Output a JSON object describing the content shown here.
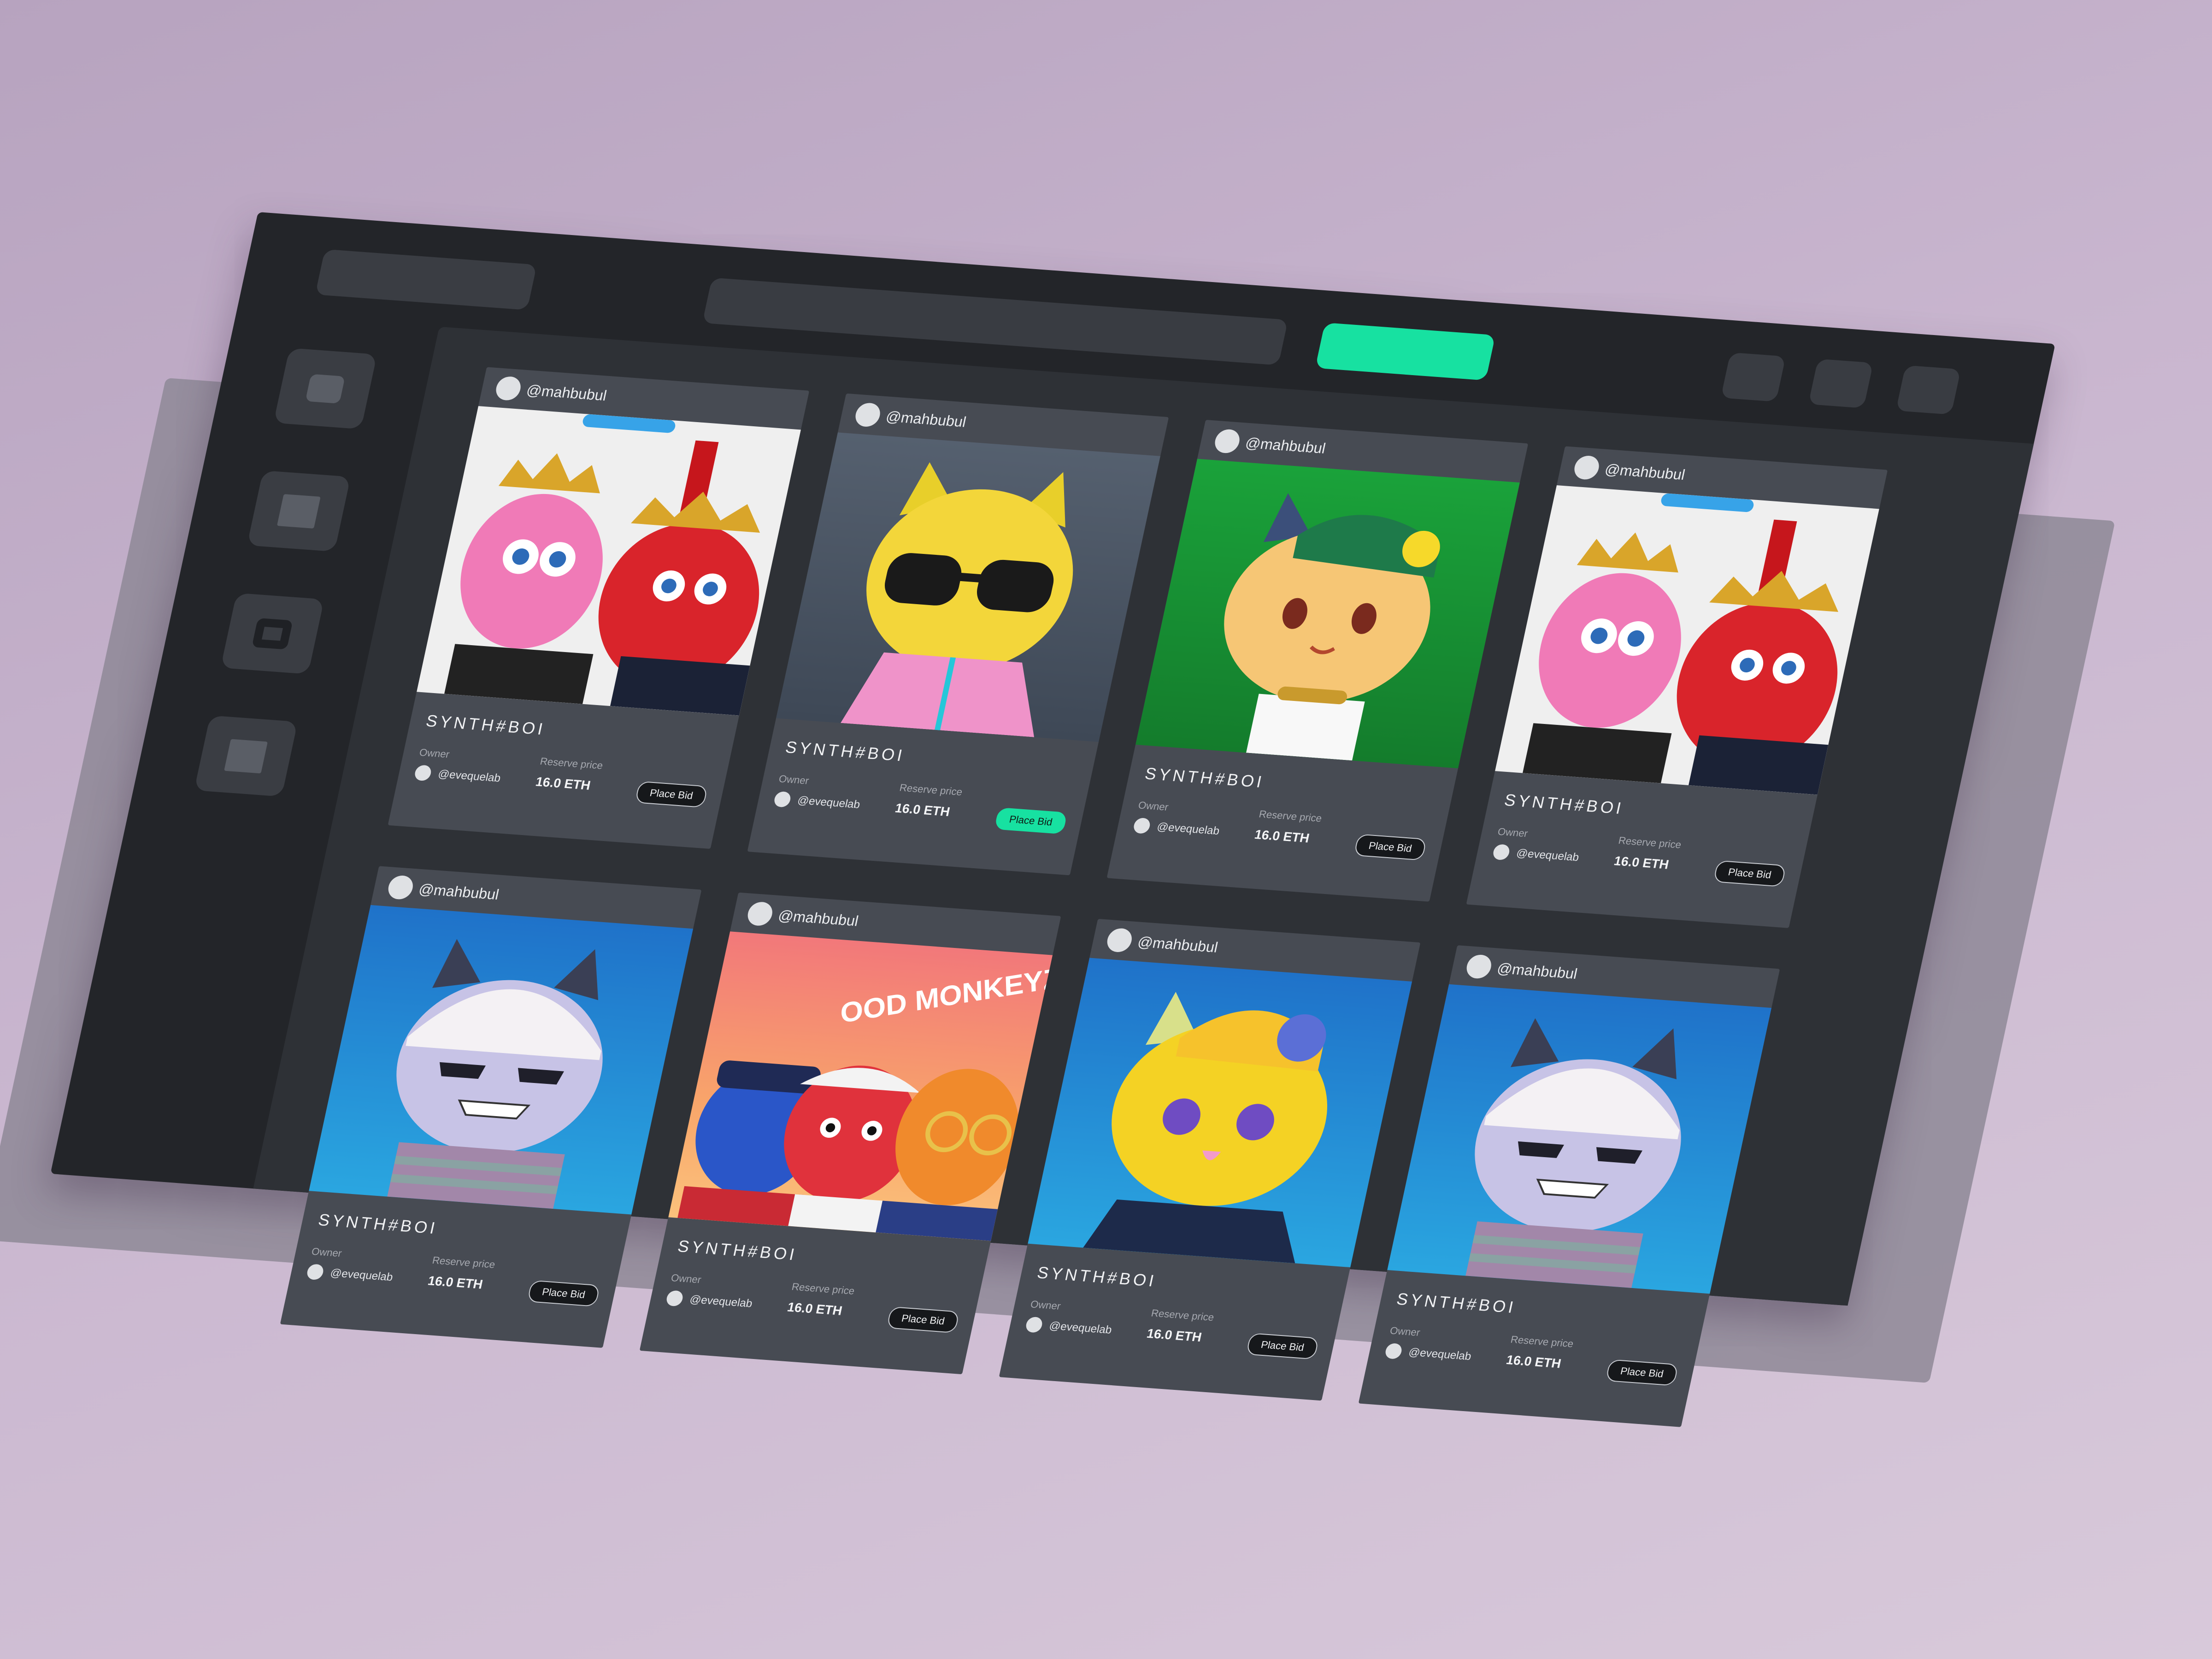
{
  "cards": [
    {
      "handle": "@mahbubul",
      "title": "SYNTH#BOI",
      "owner_label": "Owner",
      "owner": "@evequelab",
      "price_label": "Reserve price",
      "price": "16.0 ETH",
      "bid": "Place Bid",
      "art": "red-and-pink-crowned-characters"
    },
    {
      "handle": "@mahbubul",
      "title": "SYNTH#BOI",
      "owner_label": "Owner",
      "owner": "@evequelab",
      "price_label": "Reserve price",
      "price": "16.0 ETH",
      "bid": "Place Bid",
      "art": "yellow-cat-sunglasses"
    },
    {
      "handle": "@mahbubul",
      "title": "SYNTH#BOI",
      "owner_label": "Owner",
      "owner": "@evequelab",
      "price_label": "Reserve price",
      "price": "16.0 ETH",
      "bid": "Place Bid",
      "art": "cat-with-green-cap"
    },
    {
      "handle": "@mahbubul",
      "title": "SYNTH#BOI",
      "owner_label": "Owner",
      "owner": "@evequelab",
      "price_label": "Reserve price",
      "price": "16.0 ETH",
      "bid": "Place Bid",
      "art": "red-and-pink-crowned-characters"
    },
    {
      "handle": "@mahbubul",
      "title": "SYNTH#BOI",
      "owner_label": "Owner",
      "owner": "@evequelab",
      "price_label": "Reserve price",
      "price": "16.0 ETH",
      "bid": "Place Bid",
      "art": "grey-cat-helmet"
    },
    {
      "handle": "@mahbubul",
      "title": "SYNTH#BOI",
      "owner_label": "Owner",
      "owner": "@evequelab",
      "price_label": "Reserve price",
      "price": "16.0 ETH",
      "bid": "Place Bid",
      "art": "three-monkeys",
      "art_text": "OOD MONKEYZ"
    },
    {
      "handle": "@mahbubul",
      "title": "SYNTH#BOI",
      "owner_label": "Owner",
      "owner": "@evequelab",
      "price_label": "Reserve price",
      "price": "16.0 ETH",
      "bid": "Place Bid",
      "art": "yellow-cat-beanie"
    },
    {
      "handle": "@mahbubul",
      "title": "SYNTH#BOI",
      "owner_label": "Owner",
      "owner": "@evequelab",
      "price_label": "Reserve price",
      "price": "16.0 ETH",
      "bid": "Place Bid",
      "art": "grey-cat-helmet"
    }
  ],
  "theme": {
    "accent": "#17e1a1",
    "panel": "#232529",
    "card": "#474b53"
  }
}
